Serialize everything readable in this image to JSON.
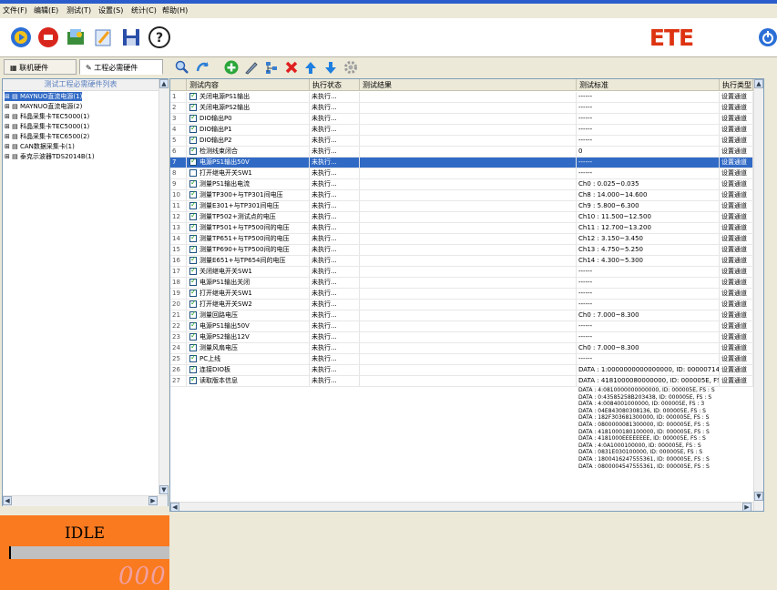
{
  "menu": [
    "文件(F)",
    "编辑(E)",
    "测试(T)",
    "设置(S)",
    "统计(C)",
    "帮助(H)"
  ],
  "toolbar": {
    "icons": [
      "run-icon",
      "stop-icon",
      "open-icon",
      "edit-icon",
      "save-icon",
      "help-icon"
    ],
    "logo": "ETE"
  },
  "left": {
    "tabs": [
      "联机硬件",
      "工程必需硬件"
    ],
    "header": "测试工程必需硬件列表",
    "items": [
      "MAYNUO直流电源(1)",
      "MAYNUO直流电源(2)",
      "科晶采集卡TEC5000(1)",
      "科晶采集卡TEC5000(1)",
      "科晶采集卡TEC6500(2)",
      "CAN数据采集卡(1)",
      "泰克示波器TDS2014B(1)"
    ]
  },
  "status": {
    "state": "IDLE",
    "counter": "000"
  },
  "grid": {
    "headers": [
      "",
      "测试内容",
      "执行状态",
      "测试结果",
      "测试标准",
      "执行类型"
    ],
    "rows": [
      {
        "n": "1",
        "checked": true,
        "name": "关闭电源PS1输出",
        "status": "未执行...",
        "std": "------",
        "type": "设置通道"
      },
      {
        "n": "2",
        "checked": true,
        "name": "关闭电源PS2输出",
        "status": "未执行...",
        "std": "------",
        "type": "设置通道"
      },
      {
        "n": "3",
        "checked": true,
        "name": "DIO输出P0",
        "status": "未执行...",
        "std": "------",
        "type": "设置通道"
      },
      {
        "n": "4",
        "checked": true,
        "name": "DIO输出P1",
        "status": "未执行...",
        "std": "------",
        "type": "设置通道"
      },
      {
        "n": "5",
        "checked": true,
        "name": "DIO输出P2",
        "status": "未执行...",
        "std": "------",
        "type": "设置通道"
      },
      {
        "n": "6",
        "checked": true,
        "name": "检测线束闭合",
        "status": "未执行...",
        "std": "0",
        "type": "设置通道"
      },
      {
        "n": "7",
        "checked": true,
        "name": "电源PS1输出50V",
        "status": "未执行...",
        "std": "------",
        "type": "设置通道"
      },
      {
        "n": "8",
        "checked": false,
        "name": "打开继电开关SW1",
        "status": "未执行...",
        "std": "------",
        "type": "设置通道"
      },
      {
        "n": "9",
        "checked": true,
        "name": "测量PS1输出电流",
        "status": "未执行...",
        "std": "Ch0 : 0.025~0.035",
        "type": "设置通道"
      },
      {
        "n": "10",
        "checked": true,
        "name": "测量TP300+与TP301间电压",
        "status": "未执行...",
        "std": "Ch8 : 14.000~14.600",
        "type": "设置通道"
      },
      {
        "n": "11",
        "checked": true,
        "name": "测量E301+与TP301间电压",
        "status": "未执行...",
        "std": "Ch9 : 5.800~6.300",
        "type": "设置通道"
      },
      {
        "n": "12",
        "checked": true,
        "name": "测量TP502+测试点的电压",
        "status": "未执行...",
        "std": "Ch10 : 11.500~12.500",
        "type": "设置通道"
      },
      {
        "n": "13",
        "checked": true,
        "name": "测量TP501+与TP500间的电压",
        "status": "未执行...",
        "std": "Ch11 : 12.700~13.200",
        "type": "设置通道"
      },
      {
        "n": "14",
        "checked": true,
        "name": "测量TP651+与TP500间的电压",
        "status": "未执行...",
        "std": "Ch12 : 3.150~3.450",
        "type": "设置通道"
      },
      {
        "n": "15",
        "checked": true,
        "name": "测量TP690+与TP500间的电压",
        "status": "未执行...",
        "std": "Ch13 : 4.750~5.250",
        "type": "设置通道"
      },
      {
        "n": "16",
        "checked": true,
        "name": "测量E651+与TP654间的电压",
        "status": "未执行...",
        "std": "Ch14 : 4.300~5.300",
        "type": "设置通道"
      },
      {
        "n": "17",
        "checked": true,
        "name": "关闭继电开关SW1",
        "status": "未执行...",
        "std": "------",
        "type": "设置通道"
      },
      {
        "n": "18",
        "checked": true,
        "name": "电源PS1输出关闭",
        "status": "未执行...",
        "std": "------",
        "type": "设置通道"
      },
      {
        "n": "19",
        "checked": true,
        "name": "打开继电开关SW1",
        "status": "未执行...",
        "std": "------",
        "type": "设置通道"
      },
      {
        "n": "20",
        "checked": true,
        "name": "打开继电开关SW2",
        "status": "未执行...",
        "std": "------",
        "type": "设置通道"
      },
      {
        "n": "21",
        "checked": true,
        "name": "测量回路电压",
        "status": "未执行...",
        "std": "Ch0 : 7.000~8.300",
        "type": "设置通道"
      },
      {
        "n": "22",
        "checked": true,
        "name": "电源PS1输出50V",
        "status": "未执行...",
        "std": "------",
        "type": "设置通道"
      },
      {
        "n": "23",
        "checked": true,
        "name": "电源PS2输出12V",
        "status": "未执行...",
        "std": "------",
        "type": "设置通道"
      },
      {
        "n": "24",
        "checked": true,
        "name": "测量风扇电压",
        "status": "未执行...",
        "std": "Ch0 : 7.000~8.300",
        "type": "设置通道"
      },
      {
        "n": "25",
        "checked": true,
        "name": "PC上线",
        "status": "未执行...",
        "std": "------",
        "type": "设置通道"
      },
      {
        "n": "26",
        "checked": true,
        "name": "连接DIO板",
        "status": "未执行...",
        "std": "DATA : 1:0000000000000000, ID: 00000714, FS : S",
        "type": "设置通道"
      },
      {
        "n": "27",
        "checked": true,
        "name": "读取版本信息",
        "status": "未执行...",
        "std": "DATA : 4181000080000000, ID: 000005E, FS : S",
        "type": "设置通道"
      }
    ],
    "extra_std_lines": [
      "DATA : 4:0810000000000000, ID: 000005E, FS : S",
      "DATA : 0:43585258B203438, ID: 000005E, FS : S",
      "DATA : 4:0084001000000, ID: 000005E, FS : 3",
      "DATA : 04E843080308136, ID: 000005E, FS : S",
      "DATA : 182F303681300000, ID: 000005E, FS : S",
      "DATA : 0800000081300000, ID: 000005E, FS : S",
      "DATA : 4181000180100000, ID: 000005E, FS : S",
      "DATA : 4181000EEEEEEEE, ID: 000005E, FS : S",
      "DATA : 4:0A1000100000, ID: 000005E, FS : S",
      "DATA : 0831E030100000, ID: 000005E, FS : S",
      "DATA : 1800416247555361, ID: 000005E, FS : S",
      "DATA : 0800004547555361, ID: 000005E, FS : S"
    ]
  }
}
